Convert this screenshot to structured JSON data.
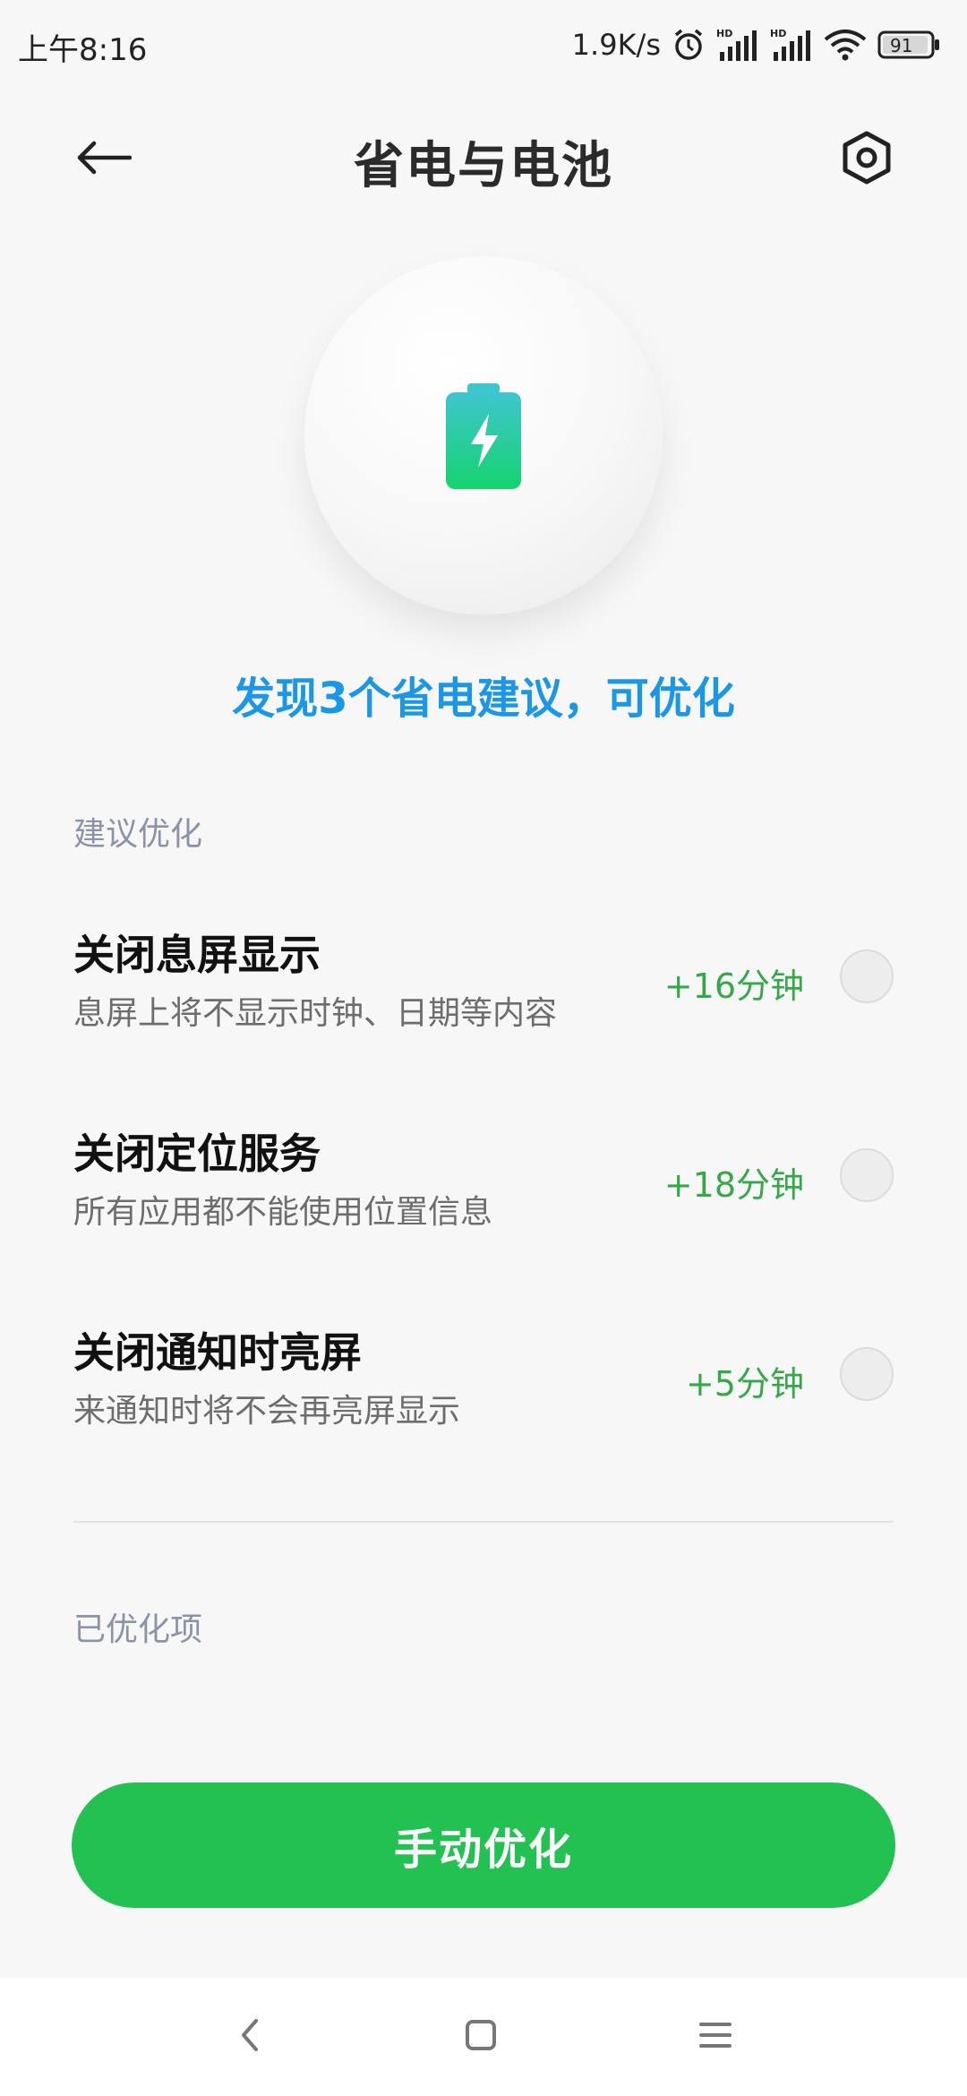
{
  "status_bar": {
    "time": "上午8:16",
    "net_speed": "1.9K/s",
    "battery_level": "91",
    "icons": [
      "alarm-icon",
      "signal-hd-icon",
      "signal-hd-icon",
      "wifi-icon",
      "battery-icon"
    ]
  },
  "header": {
    "title": "省电与电池",
    "back_icon": "arrow-left-icon",
    "settings_icon": "gear-icon"
  },
  "hero": {
    "icon": "battery-charging-icon",
    "summary": "发现3个省电建议，可优化"
  },
  "suggestions": {
    "section_label": "建议优化",
    "items": [
      {
        "title": "关闭息屏显示",
        "desc": "息屏上将不显示时钟、日期等内容",
        "gain": "+16分钟",
        "selected": false
      },
      {
        "title": "关闭定位服务",
        "desc": "所有应用都不能使用位置信息",
        "gain": "+18分钟",
        "selected": false
      },
      {
        "title": "关闭通知时亮屏",
        "desc": "来通知时将不会再亮屏显示",
        "gain": "+5分钟",
        "selected": false
      }
    ]
  },
  "optimized": {
    "section_label": "已优化项"
  },
  "action": {
    "button_label": "手动优化"
  },
  "nav": {
    "back_icon": "chevron-left-icon",
    "home_icon": "square-icon",
    "menu_icon": "menu-icon"
  },
  "colors": {
    "accent_blue": "#1b97e6",
    "gain_green": "#37a84a",
    "button_green": "#22c151",
    "background": "#f7f7f7"
  }
}
